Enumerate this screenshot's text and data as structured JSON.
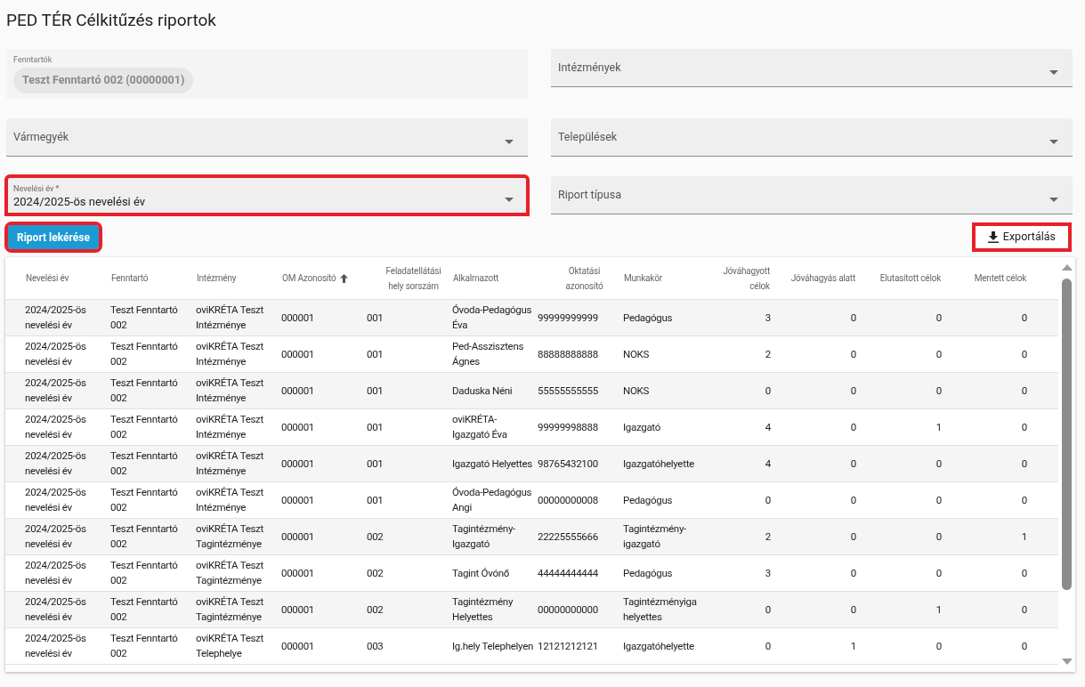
{
  "page": {
    "title": "PED TÉR Célkitűzés riportok"
  },
  "filters": [
    {
      "kind": "chip",
      "label": "Fenntartók",
      "value": "Teszt Fenntartó 002 (00000001)",
      "highlighted": false
    },
    {
      "kind": "select",
      "label": "Intézmények",
      "highlighted": false
    },
    {
      "kind": "select",
      "label": "Vármegyék",
      "highlighted": false
    },
    {
      "kind": "select",
      "label": "Települések",
      "highlighted": false
    },
    {
      "kind": "select",
      "label": "Nevelési év *",
      "value": "2024/2025-ös nevelési év",
      "highlighted": true
    },
    {
      "kind": "select",
      "label": "Riport típusa",
      "highlighted": false
    }
  ],
  "actions": {
    "query": {
      "label": "Riport lekérése",
      "highlighted": true
    },
    "export": {
      "label": "Exportálás",
      "highlighted": true
    }
  },
  "table": {
    "columns": [
      {
        "label": "Nevelési év",
        "kind": "text",
        "sorted": false
      },
      {
        "label": "Fenntartó",
        "kind": "text",
        "sorted": false
      },
      {
        "label": "Intézmény",
        "kind": "text",
        "sorted": false
      },
      {
        "label": "OM Azonosító",
        "kind": "text",
        "sorted": true
      },
      {
        "label": "Feladatellátási hely sorszám",
        "kind": "code",
        "sorted": false
      },
      {
        "label": "Alkalmazott",
        "kind": "text",
        "sorted": false
      },
      {
        "label": "Oktatási azonosító",
        "kind": "code",
        "sorted": false
      },
      {
        "label": "Munkakör",
        "kind": "text",
        "sorted": false
      },
      {
        "label": "Jóváhagyott célok",
        "kind": "count",
        "sorted": false
      },
      {
        "label": "Jóváhagyás alatt",
        "kind": "count",
        "sorted": false
      },
      {
        "label": "Elutasított célok",
        "kind": "count",
        "sorted": false
      },
      {
        "label": "Mentett célok",
        "kind": "count",
        "sorted": false
      }
    ],
    "rows": [
      [
        "2024/2025-ös nevelési év",
        "Teszt Fenntartó 002",
        "oviKRÉTA Teszt Intézménye",
        "000001",
        "001",
        "Óvoda-Pedagógus Éva",
        "99999999999",
        "Pedagógus",
        "3",
        "0",
        "0",
        "0"
      ],
      [
        "2024/2025-ös nevelési év",
        "Teszt Fenntartó 002",
        "oviKRÉTA Teszt Intézménye",
        "000001",
        "001",
        "Ped-Asszisztens Ágnes",
        "88888888888",
        "NOKS",
        "2",
        "0",
        "0",
        "0"
      ],
      [
        "2024/2025-ös nevelési év",
        "Teszt Fenntartó 002",
        "oviKRÉTA Teszt Intézménye",
        "000001",
        "001",
        "Daduska Néni",
        "55555555555",
        "NOKS",
        "0",
        "0",
        "0",
        "0"
      ],
      [
        "2024/2025-ös nevelési év",
        "Teszt Fenntartó 002",
        "oviKRÉTA Teszt Intézménye",
        "000001",
        "001",
        "oviKRÉTA-Igazgató Éva",
        "99999998888",
        "Igazgató",
        "4",
        "0",
        "1",
        "0"
      ],
      [
        "2024/2025-ös nevelési év",
        "Teszt Fenntartó 002",
        "oviKRÉTA Teszt Intézménye",
        "000001",
        "001",
        "Igazgató Helyettes",
        "98765432100",
        "Igazgatóhelyette",
        "4",
        "0",
        "0",
        "0"
      ],
      [
        "2024/2025-ös nevelési év",
        "Teszt Fenntartó 002",
        "oviKRÉTA Teszt Intézménye",
        "000001",
        "001",
        "Óvoda-Pedagógus Angi",
        "00000000008",
        "Pedagógus",
        "0",
        "0",
        "0",
        "0"
      ],
      [
        "2024/2025-ös nevelési év",
        "Teszt Fenntartó 002",
        "oviKRÉTA Teszt Tagintézménye",
        "000001",
        "002",
        "Tagintézmény-Igazgató",
        "22225555666",
        "Tagintézmény-igazgató",
        "2",
        "0",
        "0",
        "1"
      ],
      [
        "2024/2025-ös nevelési év",
        "Teszt Fenntartó 002",
        "oviKRÉTA Teszt Tagintézménye",
        "000001",
        "002",
        "Tagint Óvónő",
        "44444444444",
        "Pedagógus",
        "3",
        "0",
        "0",
        "0"
      ],
      [
        "2024/2025-ös nevelési év",
        "Teszt Fenntartó 002",
        "oviKRÉTA Teszt Tagintézménye",
        "000001",
        "002",
        "Tagintézmény Helyettes",
        "00000000000",
        "Tagintézményiga helyettes",
        "0",
        "0",
        "1",
        "0"
      ],
      [
        "2024/2025-ös nevelési év",
        "Teszt Fenntartó 002",
        "oviKRÉTA Teszt Telephelye",
        "000001",
        "003",
        "Ig.hely Telephelyen",
        "12121212121",
        "Igazgatóhelyette",
        "0",
        "1",
        "0",
        "0"
      ]
    ]
  }
}
